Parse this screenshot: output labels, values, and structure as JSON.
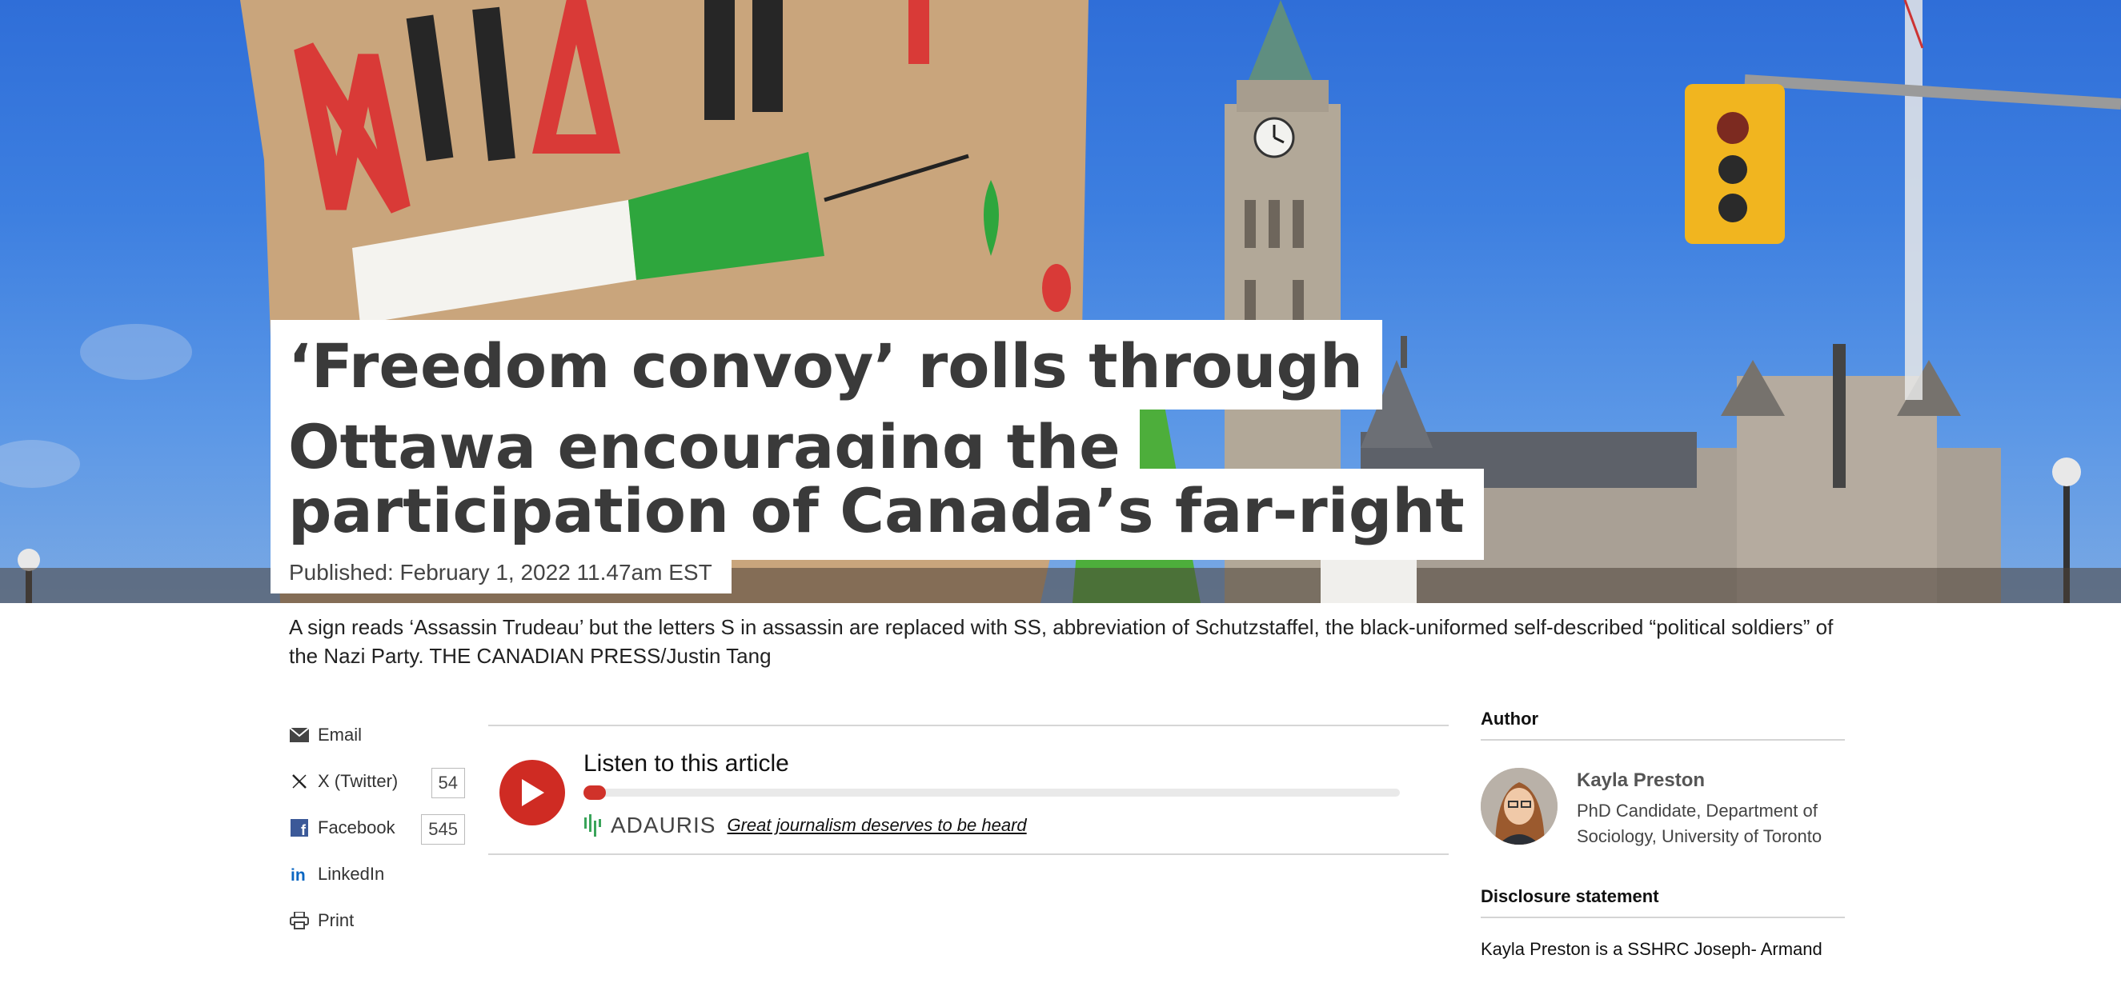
{
  "article": {
    "headline_lines": [
      "‘Freedom convoy’ rolls through",
      "Ottawa encouraging the",
      "participation of Canada’s far-right"
    ],
    "published": "Published: February 1, 2022 11.47am EST",
    "caption": "A sign reads ‘Assassin Trudeau’ but the letters S in assassin are replaced with SS, abbreviation of Schutzstaffel, the black-uniformed self-described “political soldiers” of the Nazi Party. THE CANADIAN PRESS/Justin Tang"
  },
  "share": {
    "items": [
      {
        "label": "Email",
        "icon": "envelope-icon"
      },
      {
        "label": "X (Twitter)",
        "icon": "x-icon",
        "count": "54"
      },
      {
        "label": "Facebook",
        "icon": "facebook-icon",
        "count": "545"
      },
      {
        "label": "LinkedIn",
        "icon": "linkedin-icon"
      },
      {
        "label": "Print",
        "icon": "printer-icon"
      }
    ]
  },
  "player": {
    "title": "Listen to this article",
    "progress": 0.02,
    "brand": "ADAURIS",
    "tagline": "Great journalism deserves to be heard"
  },
  "sidebar": {
    "author_heading": "Author",
    "author_name": "Kayla Preston",
    "author_role": "PhD Candidate, Department of Sociology, University of Toronto",
    "disclosure_heading": "Disclosure statement",
    "disclosure_text": "Kayla Preston is a SSHRC Joseph- Armand"
  },
  "colors": {
    "accent_red": "#cf2b23",
    "facebook_blue": "#3b5998",
    "linkedin_blue": "#0a66c2"
  }
}
